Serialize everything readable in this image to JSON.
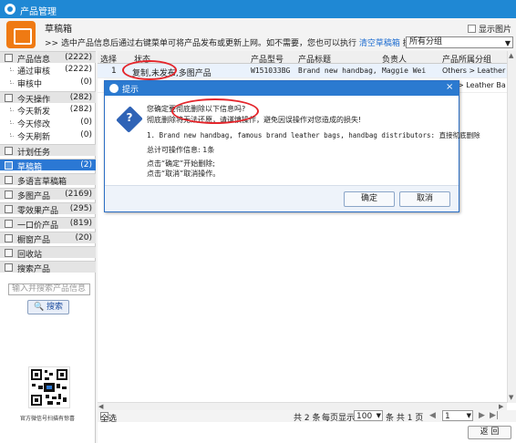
{
  "window": {
    "title": "产品管理"
  },
  "draft": {
    "title": "草稿箱",
    "tip_prefix": ">> 选中产品信息后通过右键菜单可将产品发布或更新上网。如不需要，您也可以执行 ",
    "tip_link": "清空草稿箱",
    "tip_suffix": " 操作。",
    "show_images": "显示图片",
    "group_select": "所有分组"
  },
  "sidebar": {
    "product_info": {
      "label": "产品信息",
      "count": "(2222)"
    },
    "approved": {
      "label": "通过审核",
      "count": "(2222)"
    },
    "reviewing": {
      "label": "审核中",
      "count": "(0)"
    },
    "today_ops": {
      "label": "今天操作",
      "count": "(282)"
    },
    "today_new": {
      "label": "今天新发",
      "count": "(282)"
    },
    "today_edit": {
      "label": "今天修改",
      "count": "(0)"
    },
    "today_refresh": {
      "label": "今天刷新",
      "count": "(0)"
    },
    "scheduled": {
      "label": "计划任务"
    },
    "drafts": {
      "label": "草稿箱",
      "count": "(2)"
    },
    "multilang_drafts": {
      "label": "多语言草稿箱"
    },
    "multi_image": {
      "label": "多图产品",
      "count": "(2169)"
    },
    "zero_effect": {
      "label": "零效果产品",
      "count": "(295)"
    },
    "one_price": {
      "label": "一口价产品",
      "count": "(819)"
    },
    "showcase": {
      "label": "橱窗产品",
      "count": "(20)"
    },
    "recycle": {
      "label": "回收站"
    },
    "search_products": {
      "label": "搜索产品"
    },
    "search_placeholder": "输入并搜索产品信息",
    "search_button": "搜索",
    "qr_caption": "官方微信号扫描有惊喜"
  },
  "table": {
    "headers": [
      "选择",
      "状态",
      "产品型号",
      "产品标题",
      "负责人",
      "产品所属分组"
    ],
    "rows": [
      {
        "index": "1",
        "status": "复制,未发布,多图产品",
        "model": "W151033BG",
        "title": "Brand new handbag, ...",
        "owner": "Maggie Wei",
        "group": "Others > Leather Ba..."
      },
      {
        "group": "rs > Leather Ba..."
      }
    ]
  },
  "footer": {
    "select_all": "全选",
    "total": "共 2 条",
    "per_page_label": "每页显示",
    "per_page": "100",
    "page_info": "条 共 1 页",
    "page": "1",
    "back_button": "返 回"
  },
  "dialog": {
    "title": "提示",
    "line1": "您确定要彻底删除以下信息吗?",
    "line2": "彻底删除将无法还原，请谨慎操作，避免因误操作对您造成的损失!",
    "item": "1. Brand new handbag, famous brand leather bags, handbag distributors: 直接彻底删除",
    "total": "总计可操作信息: 1条",
    "hint_confirm": "点击“确定”开始删除;",
    "hint_cancel": "点击“取消”取消操作。",
    "confirm": "确定",
    "cancel": "取消"
  },
  "colors": {
    "titlebar": "#1f88d4",
    "selected": "#2b78d4",
    "annotation": "#e4262c",
    "draft_icon": "#ef7a13"
  }
}
